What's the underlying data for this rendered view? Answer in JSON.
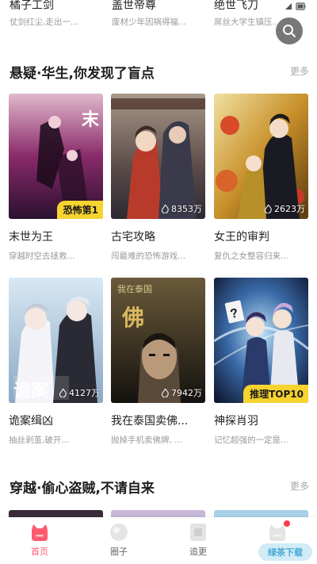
{
  "top_row": [
    {
      "title": "橘子工剑",
      "desc": "仗剑红尘,走出一..."
    },
    {
      "title": "盖世帝尊",
      "desc": "废材少年因祸得福..."
    },
    {
      "title": "绝世飞刀",
      "desc": "屌丝大学生镇压..."
    }
  ],
  "sections": [
    {
      "title": "悬疑·华生,你发现了盲点",
      "more": "更多"
    },
    {
      "title": "穿越·偷心盗贼,不请自来",
      "more": "更多"
    }
  ],
  "comics": [
    {
      "title": "末世为王",
      "desc": "穿越时空去拯救...",
      "badge": "恐怖第1",
      "views": "",
      "cover_colors": [
        "#3a1a3e",
        "#8a2a6a",
        "#d8a0c0"
      ]
    },
    {
      "title": "古宅攻略",
      "desc": "闯最难的恐怖游戏...",
      "badge": "",
      "views": "8353万",
      "cover_colors": [
        "#2b2a33",
        "#6a4a42",
        "#c7a88a"
      ]
    },
    {
      "title": "女王的审判",
      "desc": "复仇之女整容归来...",
      "badge": "",
      "views": "2623万",
      "cover_colors": [
        "#5a3a10",
        "#c8902a",
        "#f0d898"
      ]
    },
    {
      "title": "诡案缉凶",
      "desc": "抽丝剥茧,破开...",
      "badge": "",
      "views": "4127万",
      "cover_colors": [
        "#6a8aa8",
        "#c8d8e8",
        "#f2f4f6"
      ]
    },
    {
      "title": "我在泰国卖佛...",
      "desc": "抛掉手机卖佛牌, ...",
      "badge": "",
      "views": "7942万",
      "cover_colors": [
        "#1e1a12",
        "#5a4a2a",
        "#a89a6a"
      ]
    },
    {
      "title": "神探肖羽",
      "desc": "记忆超强的一定是...",
      "badge": "推理TOP10",
      "views": "",
      "cover_colors": [
        "#1a2a4a",
        "#3a6aa8",
        "#9ac8e8"
      ]
    }
  ],
  "tabs": [
    {
      "label": "首页",
      "icon": "home-icon",
      "active": true
    },
    {
      "label": "圈子",
      "icon": "circle-icon",
      "active": false
    },
    {
      "label": "追更",
      "icon": "bookmark-icon",
      "active": false
    },
    {
      "label": "",
      "icon": "profile-icon",
      "active": false
    }
  ],
  "watermark": "绿茶下载",
  "colors": {
    "accent": "#ff5a6e",
    "badge": "#f6d32e"
  }
}
